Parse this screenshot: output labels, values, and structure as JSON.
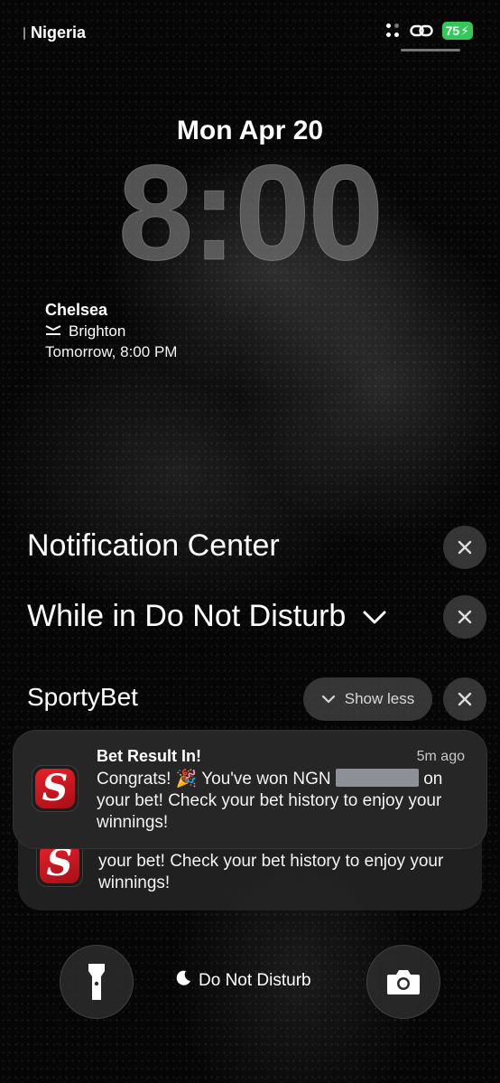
{
  "status_bar": {
    "carrier": "Nigeria",
    "battery": "75"
  },
  "lock": {
    "date": "Mon Apr 20",
    "time": "8:00"
  },
  "widget": {
    "team_home": "Chelsea",
    "team_away": "Brighton",
    "kickoff": "Tomorrow, 8:00  PM"
  },
  "notification_center": {
    "title": "Notification Center",
    "dnd_group": "While in Do Not Disturb",
    "app_name": "SportyBet",
    "show_less": "Show less"
  },
  "notifications": [
    {
      "title": "Bet Result In!",
      "time": "5m ago",
      "body_prefix": "Congrats! 🎉 You've won NGN",
      "body_suffix": "on",
      "body_rest": "your bet! Check your bet history to enjoy your winnings!"
    },
    {
      "body": "your bet! Check your bet history to enjoy your winnings!"
    }
  ],
  "bottom": {
    "dnd_label": "Do Not Disturb"
  },
  "colors": {
    "battery": "#34c759",
    "sportybet_red": "#e8202a",
    "redaction": "#8d9096"
  }
}
